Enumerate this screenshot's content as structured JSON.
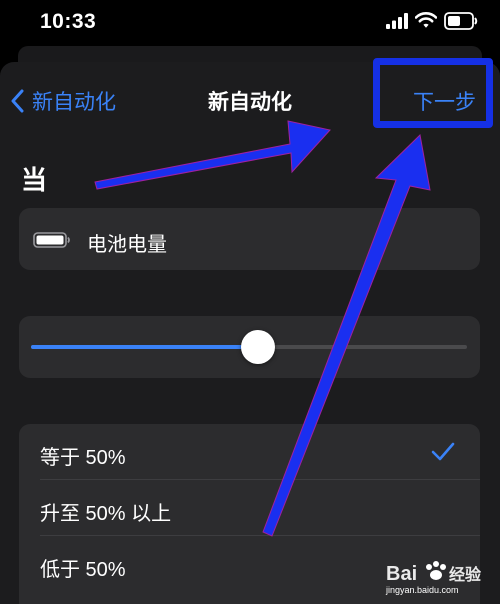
{
  "status_bar": {
    "time": "10:33"
  },
  "nav": {
    "back_label": "新自动化",
    "title": "新自动化",
    "next_label": "下一步"
  },
  "section": {
    "when_label": "当"
  },
  "trigger": {
    "label": "电池电量",
    "icon": "battery-icon"
  },
  "slider": {
    "level": 0.52
  },
  "options": [
    {
      "label": "等于 50%",
      "selected": true
    },
    {
      "label": "升至 50% 以上",
      "selected": false
    },
    {
      "label": "低于 50%",
      "selected": false
    }
  ],
  "watermark": {
    "text": "jingyan.baidu.com"
  },
  "colors": {
    "accent": "#3a82f7",
    "annotation": "#1530e6",
    "sheet_bg": "#1c1c1e",
    "card_bg": "#2c2c2e"
  }
}
